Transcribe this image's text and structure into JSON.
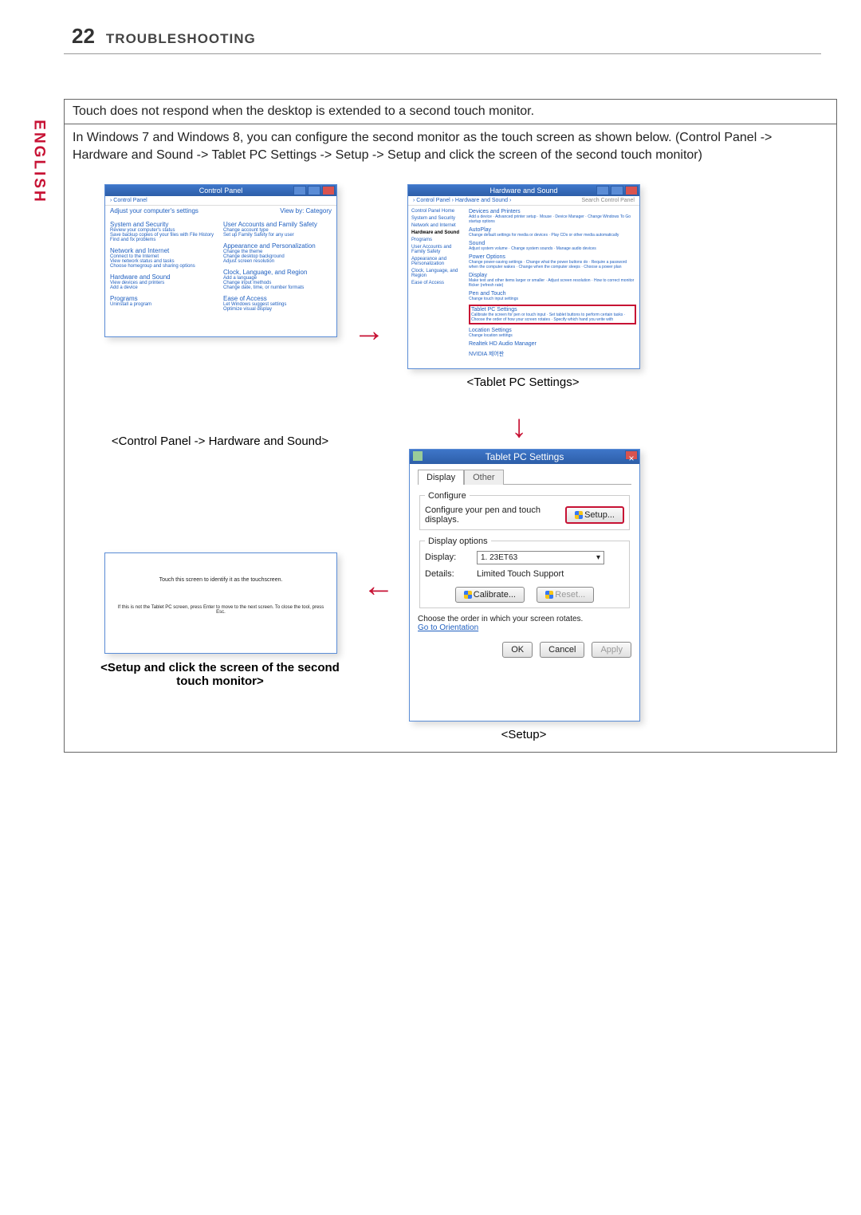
{
  "header": {
    "page_number": "22",
    "section": "TROUBLESHOOTING"
  },
  "language_tab": "ENGLISH",
  "issue_title": "Touch does not respond when the desktop is extended to a second touch monitor.",
  "issue_body": "In Windows 7 and Windows 8, you can configure the second monitor as the touch screen as shown below. (Control Panel -> Hardware and Sound -> Tablet PC Settings -> Setup -> Setup and click the screen of the second touch monitor)",
  "captions": {
    "cp": "<Control Panel -> Hardware and Sound>",
    "tablet": "<Tablet PC Settings>",
    "setup_step": "<Setup and click the screen of the second touch monitor>",
    "setup": "<Setup>"
  },
  "control_panel": {
    "window_title": "Control Panel",
    "breadcrumb": "› Control Panel",
    "adjust": "Adjust your computer's settings",
    "view_by": "View by: Category",
    "left": [
      {
        "title": "System and Security",
        "subs": [
          "Review your computer's status",
          "Save backup copies of your files with File History",
          "Find and fix problems"
        ]
      },
      {
        "title": "Network and Internet",
        "subs": [
          "Connect to the Internet",
          "View network status and tasks",
          "Choose homegroup and sharing options"
        ]
      },
      {
        "title": "Hardware and Sound",
        "subs": [
          "View devices and printers",
          "Add a device"
        ]
      },
      {
        "title": "Programs",
        "subs": [
          "Uninstall a program"
        ]
      }
    ],
    "right": [
      {
        "title": "User Accounts and Family Safety",
        "subs": [
          "Change account type",
          "Set up Family Safety for any user"
        ]
      },
      {
        "title": "Appearance and Personalization",
        "subs": [
          "Change the theme",
          "Change desktop background",
          "Adjust screen resolution"
        ]
      },
      {
        "title": "Clock, Language, and Region",
        "subs": [
          "Add a language",
          "Change input methods",
          "Change date, time, or number formats"
        ]
      },
      {
        "title": "Ease of Access",
        "subs": [
          "Let Windows suggest settings",
          "Optimize visual display"
        ]
      }
    ]
  },
  "hardware_sound": {
    "window_title": "Hardware and Sound",
    "breadcrumb": "› Control Panel › Hardware and Sound ›",
    "search_placeholder": "Search Control Panel",
    "sidebar": [
      "Control Panel Home",
      "System and Security",
      "Network and Internet",
      "Hardware and Sound",
      "Programs",
      "User Accounts and Family Safety",
      "Appearance and Personalization",
      "Clock, Language, and Region",
      "Ease of Access"
    ],
    "items": [
      {
        "title": "Devices and Printers",
        "subs": "Add a device · Advanced printer setup · Mouse · Device Manager · Change Windows To Go startup options"
      },
      {
        "title": "AutoPlay",
        "subs": "Change default settings for media or devices · Play CDs or other media automatically"
      },
      {
        "title": "Sound",
        "subs": "Adjust system volume · Change system sounds · Manage audio devices"
      },
      {
        "title": "Power Options",
        "subs": "Change power-saving settings · Change what the power buttons do · Require a password when the computer wakes · Change when the computer sleeps · Choose a power plan"
      },
      {
        "title": "Display",
        "subs": "Make text and other items larger or smaller · Adjust screen resolution · How to correct monitor flicker (refresh rate)"
      },
      {
        "title": "Pen and Touch",
        "subs": "Change touch input settings"
      },
      {
        "title": "Tablet PC Settings",
        "subs": "Calibrate the screen for pen or touch input · Set tablet buttons to perform certain tasks · Choose the order of how your screen rotates · Specify which hand you write with",
        "highlight": true
      },
      {
        "title": "Location Settings",
        "subs": "Change location settings"
      },
      {
        "title": "Realtek HD Audio Manager",
        "subs": ""
      },
      {
        "title": "NVIDIA 제어판",
        "subs": ""
      }
    ]
  },
  "touch_setup_screen": {
    "line1": "Touch this screen to identify it as the touchscreen.",
    "line2": "If this is not the Tablet PC screen, press Enter to move to the next screen. To close the tool, press Esc."
  },
  "dialog": {
    "title": "Tablet PC Settings",
    "tabs": [
      "Display",
      "Other"
    ],
    "configure_legend": "Configure",
    "configure_text": "Configure your pen and touch displays.",
    "setup_btn": "Setup...",
    "display_options_legend": "Display options",
    "display_label": "Display:",
    "display_value": "1. 23ET63",
    "details_label": "Details:",
    "details_value": "Limited Touch Support",
    "calibrate_btn": "Calibrate...",
    "reset_btn": "Reset...",
    "rotate_text": "Choose the order in which your screen rotates.",
    "orientation_link": "Go to Orientation",
    "ok": "OK",
    "cancel": "Cancel",
    "apply": "Apply"
  }
}
